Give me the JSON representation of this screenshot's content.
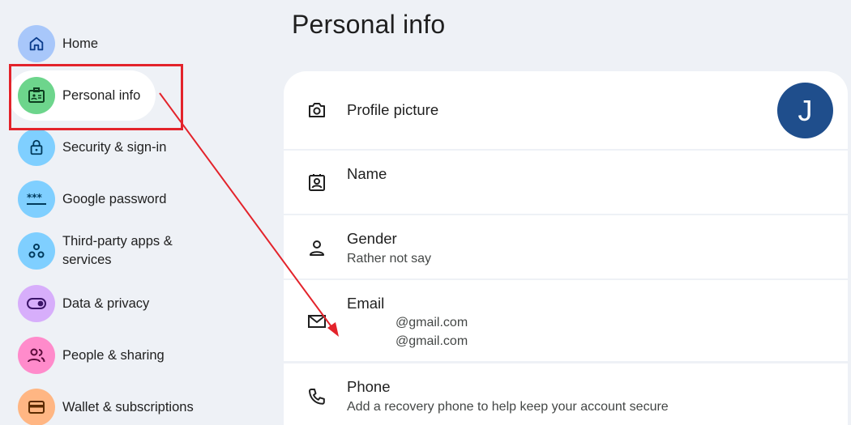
{
  "sidebar": {
    "items": [
      {
        "label": "Home",
        "icon": "home-icon",
        "color": "#a8c7fa"
      },
      {
        "label": "Personal info",
        "icon": "id-card-icon",
        "color": "#6dd58c"
      },
      {
        "label": "Security & sign-in",
        "icon": "lock-icon",
        "color": "#7fcfff"
      },
      {
        "label": "Google password",
        "icon": "password-icon",
        "color": "#7fcfff"
      },
      {
        "label": "Third-party apps & services",
        "icon": "apps-icon",
        "color": "#7fcfff"
      },
      {
        "label": "Data & privacy",
        "icon": "toggle-icon",
        "color": "#d7aefb"
      },
      {
        "label": "People & sharing",
        "icon": "people-icon",
        "color": "#ff8bcb"
      },
      {
        "label": "Wallet & subscriptions",
        "icon": "wallet-icon",
        "color": "#ffb683"
      }
    ]
  },
  "main": {
    "title": "Personal info",
    "profile": {
      "label": "Profile picture",
      "avatar_letter": "J",
      "avatar_color": "#1f4e8c"
    },
    "name": {
      "label": "Name"
    },
    "gender": {
      "label": "Gender",
      "value": "Rather not say"
    },
    "email": {
      "label": "Email",
      "values": [
        "@gmail.com",
        "@gmail.com"
      ]
    },
    "phone": {
      "label": "Phone",
      "value": "Add a recovery phone to help keep your account secure"
    }
  },
  "annotation": {
    "color": "#e3232b"
  }
}
